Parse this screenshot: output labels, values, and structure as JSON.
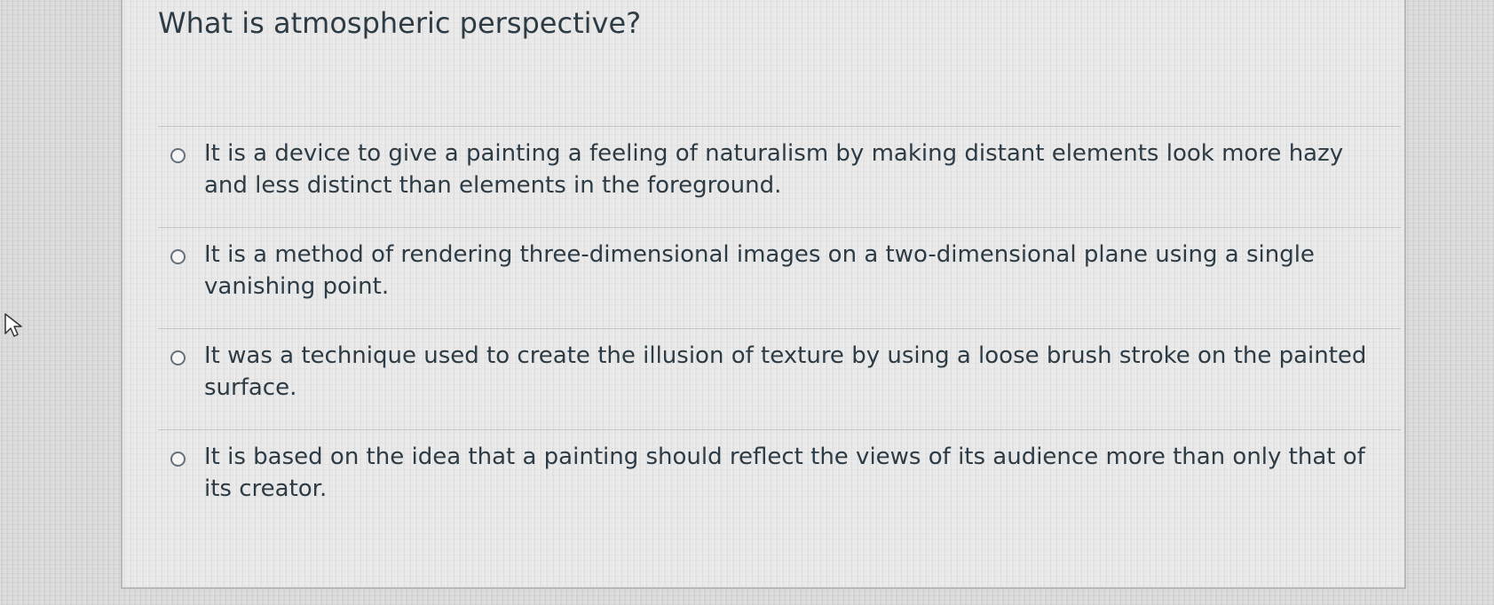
{
  "question": {
    "text": "What is atmospheric perspective?"
  },
  "answers": [
    {
      "label": "It is a device to give a painting a feeling of naturalism by making distant elements look more hazy and less distinct than elements in the foreground.",
      "selected": false
    },
    {
      "label": "It is a method of rendering three-dimensional images on a two-dimensional plane using a single vanishing point.",
      "selected": false
    },
    {
      "label": "It was a technique used to create the illusion of texture by using a loose brush stroke on the painted surface.",
      "selected": false
    },
    {
      "label": "It is based on the idea that a painting should reflect the views of its audience more than only that of its creator.",
      "selected": false
    }
  ],
  "icons": {
    "cursor": "mouse-pointer-icon",
    "radio": "radio-unselected-icon"
  },
  "colors": {
    "text": "#2d3b45",
    "radio_border": "#66717b",
    "divider": "#c4c4c4"
  }
}
